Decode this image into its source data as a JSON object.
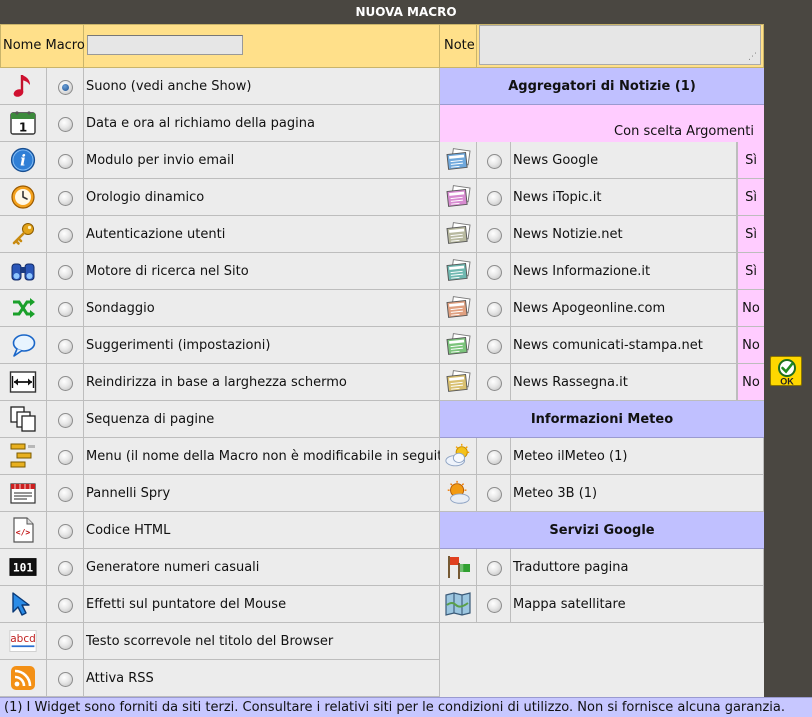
{
  "window": {
    "title": "NUOVA MACRO"
  },
  "header": {
    "nome_label": "Nome Macro",
    "nome_value": "",
    "note_label": "Note",
    "note_value": ""
  },
  "left_items": [
    {
      "label": "Suono (vedi anche Show)",
      "icon": "music-note-icon",
      "checked": true
    },
    {
      "label": "Data e ora al richiamo della pagina",
      "icon": "calendar-icon",
      "checked": false
    },
    {
      "label": "Modulo per invio email",
      "icon": "info-icon",
      "checked": false
    },
    {
      "label": "Orologio dinamico",
      "icon": "clock-icon",
      "checked": false
    },
    {
      "label": "Autenticazione utenti",
      "icon": "key-icon",
      "checked": false
    },
    {
      "label": "Motore di ricerca nel Sito",
      "icon": "binoculars-icon",
      "checked": false
    },
    {
      "label": "Sondaggio",
      "icon": "shuffle-arrows-icon",
      "checked": false
    },
    {
      "label": "Suggerimenti (impostazioni)",
      "icon": "speech-bubble-icon",
      "checked": false
    },
    {
      "label": "Reindirizza in base a larghezza schermo",
      "icon": "width-arrows-icon",
      "checked": false
    },
    {
      "label": "Sequenza di pagine",
      "icon": "pages-sequence-icon",
      "checked": false
    },
    {
      "label": "Menu (il nome della Macro non è modificabile in seguito)",
      "icon": "menu-tree-icon",
      "checked": false
    },
    {
      "label": "Pannelli Spry",
      "icon": "panels-icon",
      "checked": false
    },
    {
      "label": "Codice HTML",
      "icon": "html-code-icon",
      "checked": false
    },
    {
      "label": "Generatore numeri casuali",
      "icon": "random-numbers-icon",
      "checked": false
    },
    {
      "label": "Effetti sul puntatore del Mouse",
      "icon": "mouse-pointer-icon",
      "checked": false
    },
    {
      "label": "Testo scorrevole nel titolo del Browser",
      "icon": "scrolling-text-icon",
      "checked": false
    },
    {
      "label": "Attiva RSS",
      "icon": "rss-icon",
      "checked": false
    }
  ],
  "news": {
    "header": "Aggregatori di Notizie (1)",
    "subheader": "Con scelta Argomenti",
    "items": [
      {
        "label": "News Google",
        "flag": "Sì",
        "color": "#6fa8dc"
      },
      {
        "label": "News iTopic.it",
        "flag": "Sì",
        "color": "#d78bd0"
      },
      {
        "label": "News Notizie.net",
        "flag": "Sì",
        "color": "#b8b9a0"
      },
      {
        "label": "News Informazione.it",
        "flag": "Sì",
        "color": "#6fb8b0"
      },
      {
        "label": "News Apogeonline.com",
        "flag": "No",
        "color": "#e0a080"
      },
      {
        "label": "News comunicati-stampa.net",
        "flag": "No",
        "color": "#7cc47c"
      },
      {
        "label": "News Rassegna.it",
        "flag": "No",
        "color": "#d9c070"
      }
    ]
  },
  "meteo": {
    "header": "Informazioni Meteo",
    "items": [
      {
        "label": "Meteo ilMeteo (1)",
        "icon": "weather-cloud-sun-icon"
      },
      {
        "label": "Meteo 3B (1)",
        "icon": "weather-sun-cloud-icon"
      }
    ]
  },
  "google": {
    "header": "Servizi Google",
    "items": [
      {
        "label": "Traduttore pagina",
        "icon": "translate-flags-icon"
      },
      {
        "label": "Mappa satellitare",
        "icon": "map-icon"
      }
    ]
  },
  "ok_button": {
    "label": "OK"
  },
  "footer": {
    "text": "(1) I Widget sono forniti da siti terzi. Consultare i relativi siti per le condizioni di utilizzo. Non si fornisce alcuna garanzia."
  },
  "colors": {
    "header_bg": "#ffe08a",
    "section_bg": "#c0c0ff",
    "pink": "#ffccff",
    "frame": "#4a4741"
  }
}
